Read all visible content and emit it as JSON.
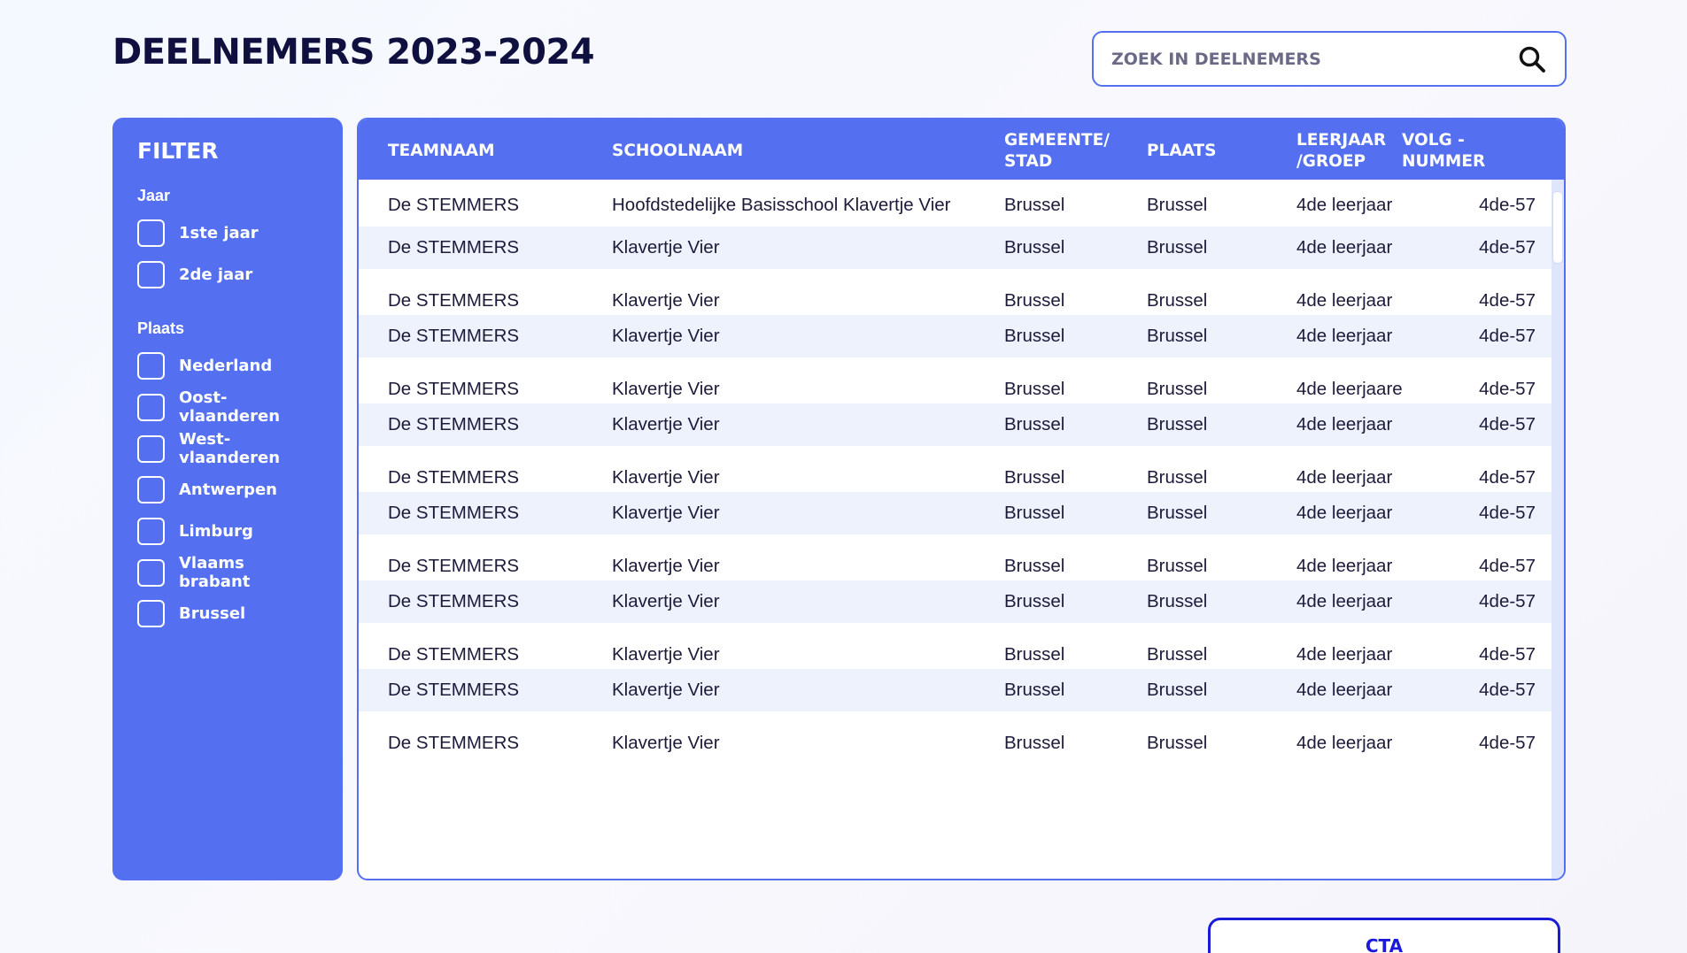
{
  "header": {
    "title": "DEELNEMERS 2023-2024"
  },
  "search": {
    "placeholder": "ZOEK IN DEELNEMERS"
  },
  "filter": {
    "title": "FILTER",
    "groups": [
      {
        "label": "Jaar",
        "options": [
          "1ste jaar",
          "2de jaar"
        ]
      },
      {
        "label": "Plaats",
        "options": [
          "Nederland",
          "Oost-vlaanderen",
          "West- vlaanderen",
          "Antwerpen",
          "Limburg",
          "Vlaams brabant",
          "Brussel"
        ]
      }
    ]
  },
  "table": {
    "columns": [
      "TEAMNAAM",
      "SCHOOLNAAM",
      "GEMEENTE/\nSTAD",
      "PLAATS",
      "LEERJAAR\n/GROEP",
      "VOLG -\nNUMMER"
    ],
    "rows": [
      [
        "De STEMMERS",
        "Hoofdstedelijke Basisschool Klavertje Vier",
        "Brussel",
        "Brussel",
        "4de leerjaar",
        "4de-57"
      ],
      [
        "De STEMMERS",
        "Klavertje Vier",
        "Brussel",
        "Brussel",
        "4de leerjaar",
        "4de-57"
      ],
      [
        "De STEMMERS",
        "Klavertje Vier",
        "Brussel",
        "Brussel",
        "4de leerjaar",
        "4de-57"
      ],
      [
        "De STEMMERS",
        "Klavertje Vier",
        "Brussel",
        "Brussel",
        "4de leerjaar",
        "4de-57"
      ],
      [
        "De STEMMERS",
        "Klavertje Vier",
        "Brussel",
        "Brussel",
        "4de leerjaare",
        "4de-57"
      ],
      [
        "De STEMMERS",
        "Klavertje Vier",
        "Brussel",
        "Brussel",
        "4de leerjaar",
        "4de-57"
      ],
      [
        "De STEMMERS",
        "Klavertje Vier",
        "Brussel",
        "Brussel",
        "4de leerjaar",
        "4de-57"
      ],
      [
        "De STEMMERS",
        "Klavertje Vier",
        "Brussel",
        "Brussel",
        "4de leerjaar",
        "4de-57"
      ],
      [
        "De STEMMERS",
        "Klavertje Vier",
        "Brussel",
        "Brussel",
        "4de leerjaar",
        "4de-57"
      ],
      [
        "De STEMMERS",
        "Klavertje Vier",
        "Brussel",
        "Brussel",
        "4de leerjaar",
        "4de-57"
      ],
      [
        "De STEMMERS",
        "Klavertje Vier",
        "Brussel",
        "Brussel",
        "4de leerjaar",
        "4de-57"
      ],
      [
        "De STEMMERS",
        "Klavertje Vier",
        "Brussel",
        "Brussel",
        "4de leerjaar",
        "4de-57"
      ],
      [
        "De STEMMERS",
        "Klavertje Vier",
        "Brussel",
        "Brussel",
        "4de leerjaar",
        "4de-57"
      ]
    ]
  },
  "cta": {
    "label": "CTA"
  },
  "icons": {
    "search": "search-icon"
  },
  "colors": {
    "accent": "#5470f0",
    "cta": "#1a1ad8",
    "row_alt": "#eef2fd"
  }
}
